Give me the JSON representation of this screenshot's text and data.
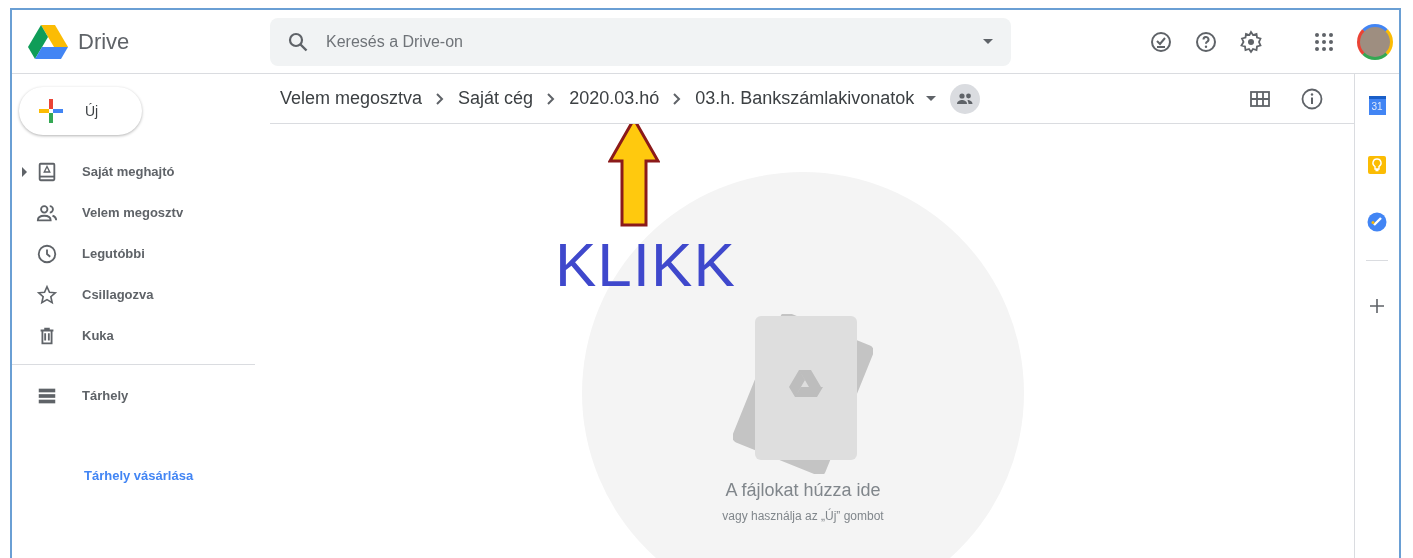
{
  "app": {
    "name": "Drive"
  },
  "search": {
    "placeholder": "Keresés a Drive-on"
  },
  "new_button": {
    "label": "Új"
  },
  "sidebar": {
    "items": [
      {
        "kind": "drive",
        "label": "Saját meghajtó",
        "collapsible": true
      },
      {
        "kind": "shared",
        "label": "Velem megosztv",
        "collapsible": false
      },
      {
        "kind": "recent",
        "label": "Legutóbbi",
        "collapsible": false
      },
      {
        "kind": "starred",
        "label": "Csillagozva",
        "collapsible": false
      },
      {
        "kind": "trash",
        "label": "Kuka",
        "collapsible": false
      }
    ],
    "storage": {
      "label": "Tárhely"
    },
    "buy_link": "Tárhely vásárlása"
  },
  "breadcrumb": [
    "Velem megosztva",
    "Saját cég",
    "2020.03.hó",
    "03.h. Bankszámlakivonatok"
  ],
  "empty_state": {
    "title": "A fájlokat húzza ide",
    "subtitle": "vagy használja az „Új” gombot"
  },
  "annotation": {
    "text": "KLIKK"
  },
  "side_panel": {
    "calendar_day": "31"
  }
}
